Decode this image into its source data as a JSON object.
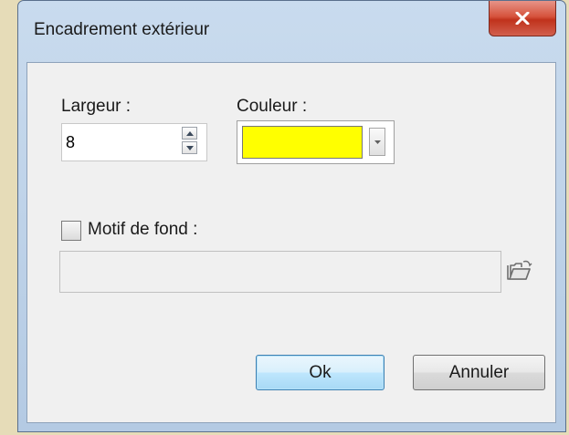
{
  "window": {
    "title": "Encadrement extérieur"
  },
  "title_bar": {
    "close_icon": "close-icon"
  },
  "width": {
    "label": "Largeur :",
    "value": "8"
  },
  "color": {
    "label": "Couleur :",
    "selected_color": "#ffff00"
  },
  "pattern": {
    "label": "Motif de fond :",
    "checked": false,
    "path_value": "",
    "browse_icon": "folder-open-icon"
  },
  "buttons": {
    "ok": "Ok",
    "cancel": "Annuler"
  }
}
